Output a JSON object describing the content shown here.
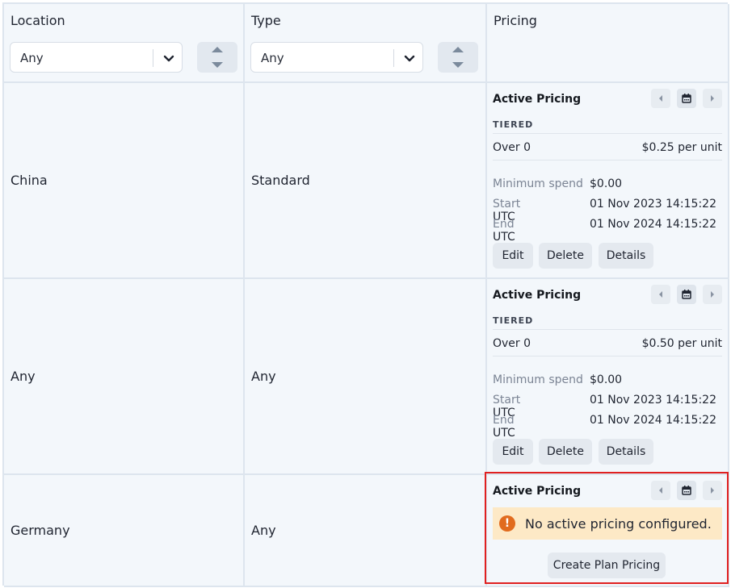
{
  "header": {
    "location_label": "Location",
    "type_label": "Type",
    "pricing_label": "Pricing",
    "location_filter_value": "Any",
    "type_filter_value": "Any"
  },
  "rows": [
    {
      "location": "China",
      "type": "Standard",
      "pricing": {
        "title": "Active Pricing",
        "tier_label": "TIERED",
        "tier_from": "Over 0",
        "tier_price": "$0.25 per unit",
        "min_spend_label": "Minimum spend",
        "min_spend_value": "$0.00",
        "start_label": "Start",
        "start_value": "01 Nov 2023 14:15:22 UTC",
        "end_label": "End",
        "end_value": "01 Nov 2024 14:15:22 UTC",
        "edit": "Edit",
        "delete": "Delete",
        "details": "Details"
      }
    },
    {
      "location": "Any",
      "type": "Any",
      "pricing": {
        "title": "Active Pricing",
        "tier_label": "TIERED",
        "tier_from": "Over 0",
        "tier_price": "$0.50 per unit",
        "min_spend_label": "Minimum spend",
        "min_spend_value": "$0.00",
        "start_label": "Start",
        "start_value": "01 Nov 2023 14:15:22 UTC",
        "end_label": "End",
        "end_value": "01 Nov 2024 14:15:22 UTC",
        "edit": "Edit",
        "delete": "Delete",
        "details": "Details"
      }
    },
    {
      "location": "Germany",
      "type": "Any",
      "pricing": {
        "title": "Active Pricing",
        "alert_icon": "!",
        "alert_text": "No active pricing configured.",
        "create": "Create Plan Pricing"
      }
    }
  ],
  "colors": {
    "highlight": "#e02020",
    "alert_bg": "#fde9c6",
    "alert_icon": "#e16b1e"
  },
  "icons": {
    "select_chevron": "chevron-down-icon",
    "sort": "sort-arrows-icon",
    "prev": "caret-left-icon",
    "calendar": "calendar-icon",
    "next": "caret-right-icon",
    "warning": "exclamation-circle-icon"
  }
}
